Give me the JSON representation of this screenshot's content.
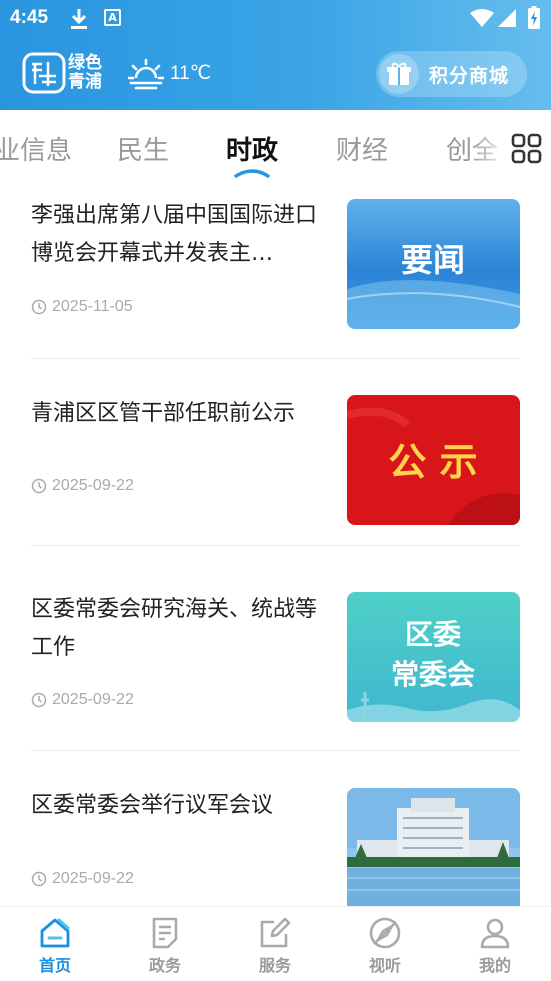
{
  "status_bar": {
    "time": "4:45",
    "a_badge": "A"
  },
  "header": {
    "logo_text_line1": "绿色",
    "logo_text_line2": "青浦",
    "weather_temp": "11℃",
    "mall_button": {
      "label": "积分商城",
      "icon": "gift-icon"
    }
  },
  "tabs": {
    "items": [
      {
        "label": "业信息"
      },
      {
        "label": "民生"
      },
      {
        "label": "时政",
        "active": true
      },
      {
        "label": "财经"
      },
      {
        "label": "创全"
      }
    ],
    "more_icon": "grid-icon"
  },
  "news": [
    {
      "title": "李强出席第八届中国国际进口博览会开幕式并发表主…",
      "date": "2025-11-05",
      "thumb_text": "要闻"
    },
    {
      "title": "青浦区区管干部任职前公示",
      "date": "2025-09-22",
      "thumb_text": "公 示"
    },
    {
      "title": "区委常委会研究海关、统战等工作",
      "date": "2025-09-22",
      "thumb_text_line1": "区委",
      "thumb_text_line2": "常委会"
    },
    {
      "title": "区委常委会举行议军会议",
      "date": "2025-09-22",
      "thumb_text": ""
    }
  ],
  "bottom_nav": {
    "items": [
      {
        "label": "首页",
        "icon": "home-icon",
        "active": true
      },
      {
        "label": "政务",
        "icon": "document-icon"
      },
      {
        "label": "服务",
        "icon": "edit-icon"
      },
      {
        "label": "视听",
        "icon": "compass-icon"
      },
      {
        "label": "我的",
        "icon": "user-icon"
      }
    ]
  },
  "colors": {
    "brand": "#2a95df",
    "active_nav": "#1a8fe0",
    "meta": "#aaaaaa"
  }
}
